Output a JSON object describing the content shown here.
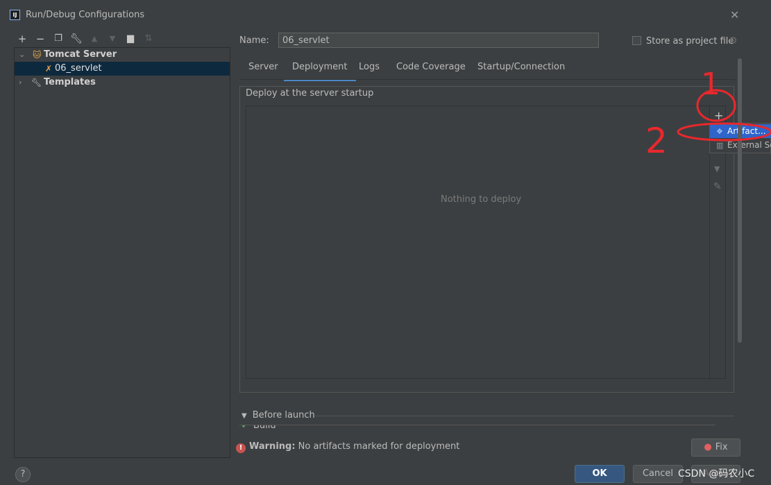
{
  "window": {
    "title": "Run/Debug Configurations"
  },
  "toolbar": {
    "icons": [
      "add-icon",
      "remove-icon",
      "copy-icon",
      "wrench-icon",
      "move-up-icon",
      "move-down-icon",
      "folder-icon",
      "sort-icon"
    ]
  },
  "tree": {
    "items": [
      {
        "label": "Tomcat Server",
        "expanded": true,
        "bold": true
      },
      {
        "label": "06_servlet",
        "selected": true
      },
      {
        "label": "Templates",
        "expanded": false,
        "bold": true
      }
    ]
  },
  "config": {
    "name_label": "Name:",
    "name_value": "06_servlet",
    "store_label": "Store as project file",
    "store_checked": false
  },
  "tabs": [
    {
      "label": "Server",
      "active": false
    },
    {
      "label": "Deployment",
      "active": true
    },
    {
      "label": "Logs",
      "active": false
    },
    {
      "label": "Code Coverage",
      "active": false
    },
    {
      "label": "Startup/Connection",
      "active": false
    }
  ],
  "deployment": {
    "group_title": "Deploy at the server startup",
    "empty_text": "Nothing to deploy",
    "add_symbol": "+",
    "popup": [
      {
        "label": "Artifact...",
        "selected": true
      },
      {
        "label": "External Sc",
        "selected": false
      }
    ]
  },
  "before_launch": {
    "label": "Before launch",
    "build_label": "Build"
  },
  "warning": {
    "bold": "Warning:",
    "text": " No artifacts marked for deployment"
  },
  "buttons": {
    "fix": "Fix",
    "help": "?",
    "ok": "OK",
    "cancel": "Cancel",
    "apply": "Apply"
  },
  "annotations": {
    "one": "1",
    "two": "2"
  },
  "watermark": "CSDN @码农小C",
  "colors": {
    "background": "#3c3f41",
    "selection": "#0d293e",
    "popup_selection": "#2f65ca",
    "tab_underline": "#4a88c7",
    "annotation_red": "#e8282d",
    "ok_button": "#365880"
  }
}
